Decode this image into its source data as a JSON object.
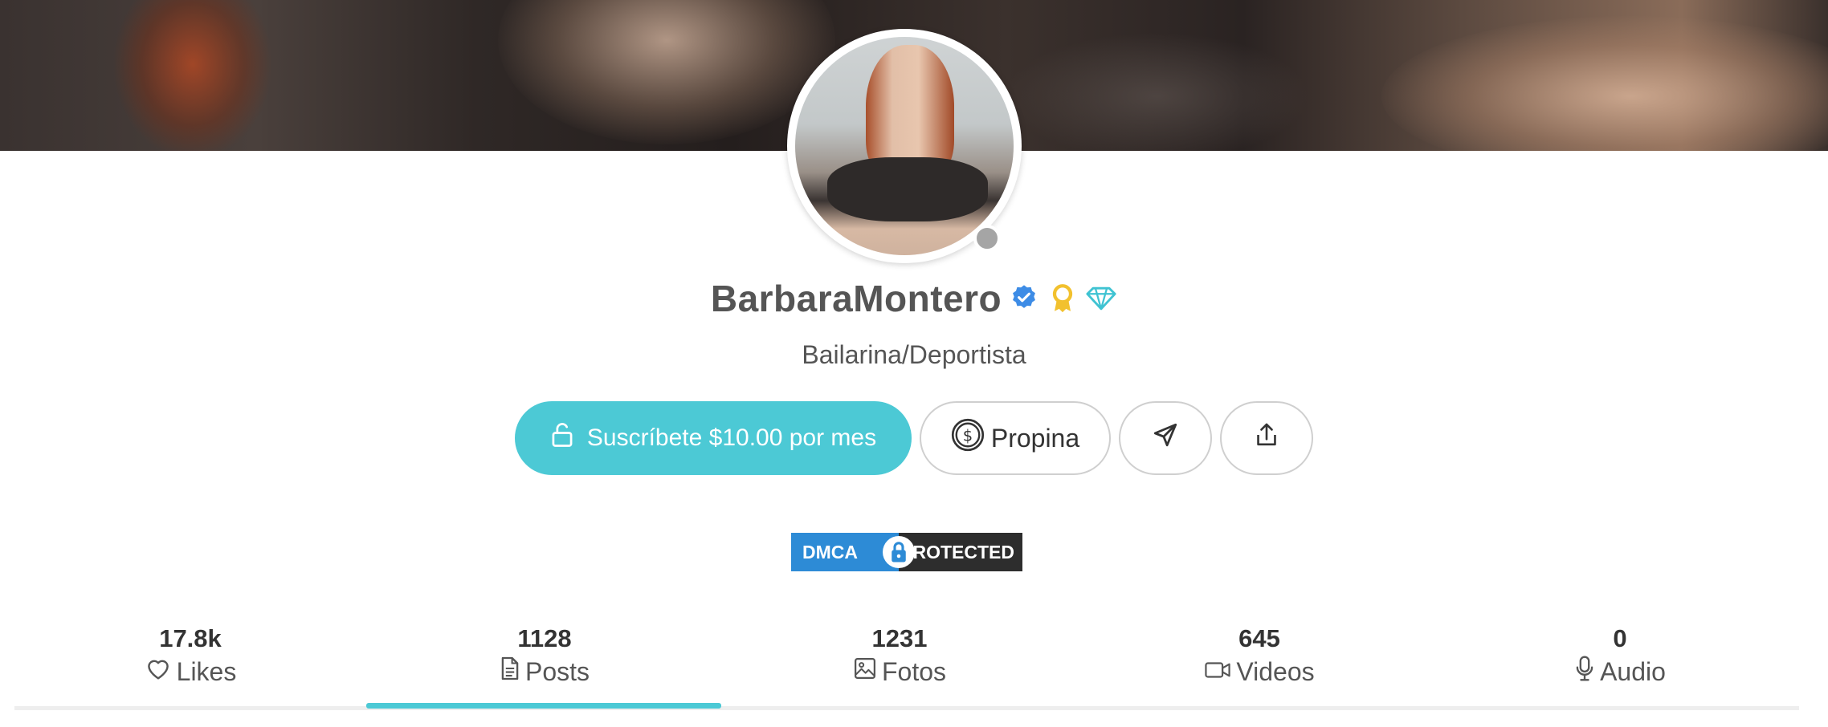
{
  "profile": {
    "name": "BarbaraMontero",
    "bio": "Bailarina/Deportista",
    "status": "offline"
  },
  "actions": {
    "subscribe_label": "Suscríbete $10.00 por mes",
    "tip_label": "Propina"
  },
  "dmca": {
    "left_text": "DMCA",
    "right_text": "PROTECTED"
  },
  "stats": [
    {
      "value": "17.8k",
      "label": "Likes",
      "icon": "heart-icon"
    },
    {
      "value": "1128",
      "label": "Posts",
      "icon": "document-icon",
      "active": true
    },
    {
      "value": "1231",
      "label": "Fotos",
      "icon": "image-icon"
    },
    {
      "value": "645",
      "label": "Videos",
      "icon": "video-icon"
    },
    {
      "value": "0",
      "label": "Audio",
      "icon": "microphone-icon"
    }
  ],
  "colors": {
    "accent": "#4cc9d5",
    "verified": "#3d8ce6",
    "award": "#f2c12e",
    "diamond": "#3fc3d2",
    "status_dot": "#a5a5a5"
  }
}
